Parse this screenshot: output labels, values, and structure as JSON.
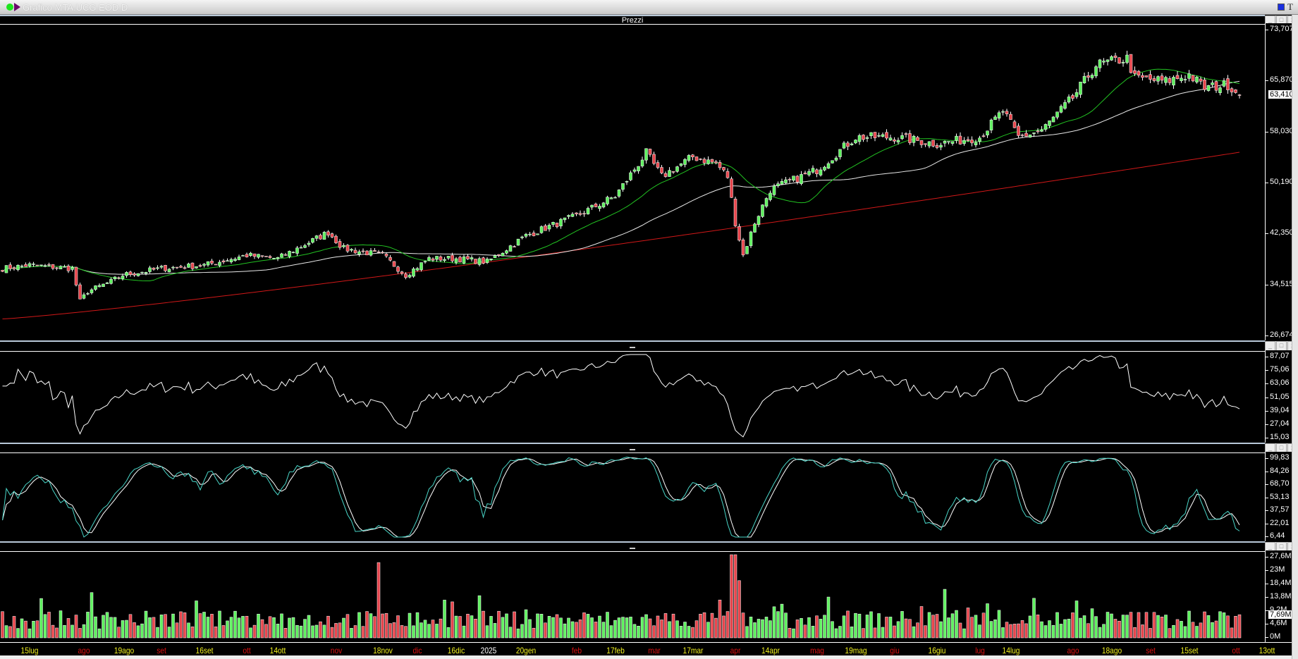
{
  "window": {
    "title": "Grafico MTA.UCG EOD D"
  },
  "panels": {
    "price": {
      "title": "Prezzi",
      "axis": [
        "73,707",
        "65,870",
        "58,030",
        "50,190",
        "42,350",
        "34,515",
        "26,674"
      ],
      "range": [
        26.674,
        73.707
      ],
      "current": "63,410"
    },
    "rsi": {
      "title": "",
      "axis": [
        "87,07",
        "75,06",
        "63,06",
        "51,05",
        "39,04",
        "27,04",
        "15,03"
      ],
      "range": [
        15.03,
        87.07
      ]
    },
    "stoch": {
      "title": "",
      "axis": [
        "99,83",
        "84,26",
        "68,70",
        "53,13",
        "37,57",
        "22,01",
        "6,44"
      ],
      "range": [
        6.44,
        99.83
      ]
    },
    "volume": {
      "title": "",
      "axis": [
        "27,6M",
        "23M",
        "18,4M",
        "13,8M",
        "9,2M",
        "4,6M",
        "0M"
      ],
      "range": [
        0,
        27.6
      ],
      "current": "7,69M"
    }
  },
  "buttons": {
    "min": "_",
    "max": "□",
    "close": "x"
  },
  "colors": {
    "up": "#5ef25e",
    "down": "#e8444b",
    "ma_short": "#22c322",
    "ma_mid": "#e8e8e8",
    "ma_long": "#d01818",
    "stoch_k": "#49d6c8",
    "stoch_d": "#ffffff",
    "day_label": "#f0f020",
    "month_label": "#dd1111",
    "year_label": "#ffffff"
  },
  "chart_data": {
    "type": "candlestick",
    "bars": 320,
    "close_anchors": [
      [
        0,
        37
      ],
      [
        7,
        37.5
      ],
      [
        18,
        37
      ],
      [
        20,
        32
      ],
      [
        22,
        33.5
      ],
      [
        28,
        35
      ],
      [
        31,
        36
      ],
      [
        41,
        37
      ],
      [
        52,
        37.5
      ],
      [
        63,
        39
      ],
      [
        71,
        38.5
      ],
      [
        84,
        42.5
      ],
      [
        88,
        40
      ],
      [
        98,
        39
      ],
      [
        104,
        36
      ],
      [
        110,
        38.5
      ],
      [
        117,
        38.5
      ],
      [
        125,
        38
      ],
      [
        135,
        42
      ],
      [
        148,
        45
      ],
      [
        158,
        48
      ],
      [
        166,
        54.6
      ],
      [
        170,
        51
      ],
      [
        178,
        54
      ],
      [
        184,
        53
      ],
      [
        187,
        51
      ],
      [
        189,
        44
      ],
      [
        191,
        39
      ],
      [
        194,
        44
      ],
      [
        198,
        49
      ],
      [
        210,
        52
      ],
      [
        220,
        57
      ],
      [
        230,
        57
      ],
      [
        241,
        56
      ],
      [
        252,
        57
      ],
      [
        258,
        61
      ],
      [
        262,
        57
      ],
      [
        268,
        58
      ],
      [
        276,
        63
      ],
      [
        282,
        68
      ],
      [
        290,
        69
      ],
      [
        292,
        66
      ],
      [
        300,
        65.5
      ],
      [
        306,
        66.5
      ],
      [
        310,
        64.5
      ],
      [
        316,
        65
      ],
      [
        319,
        63.41
      ]
    ],
    "ma_long_range": [
      29.3,
      54.7
    ],
    "volume_spikes": [
      [
        97,
        25
      ],
      [
        188,
        27.6
      ],
      [
        189,
        27.6
      ],
      [
        190,
        19
      ]
    ],
    "last_volume": 7.69,
    "date_labels": [
      {
        "i": 7,
        "t": "15lug",
        "k": "day"
      },
      {
        "i": 21,
        "t": "ago",
        "k": "month"
      },
      {
        "i": 31.4,
        "t": "19ago",
        "k": "day"
      },
      {
        "i": 41,
        "t": "set",
        "k": "month"
      },
      {
        "i": 52,
        "t": "16set",
        "k": "day"
      },
      {
        "i": 63,
        "t": "ott",
        "k": "month"
      },
      {
        "i": 71,
        "t": "14ott",
        "k": "day"
      },
      {
        "i": 86,
        "t": "nov",
        "k": "month"
      },
      {
        "i": 98,
        "t": "18nov",
        "k": "day"
      },
      {
        "i": 107,
        "t": "dic",
        "k": "month"
      },
      {
        "i": 117,
        "t": "16dic",
        "k": "day"
      },
      {
        "i": 125.4,
        "t": "2025",
        "k": "year"
      },
      {
        "i": 135,
        "t": "20gen",
        "k": "day"
      },
      {
        "i": 148,
        "t": "feb",
        "k": "month"
      },
      {
        "i": 158,
        "t": "17feb",
        "k": "day"
      },
      {
        "i": 168,
        "t": "mar",
        "k": "month"
      },
      {
        "i": 178,
        "t": "17mar",
        "k": "day"
      },
      {
        "i": 189,
        "t": "apr",
        "k": "month"
      },
      {
        "i": 198,
        "t": "14apr",
        "k": "day"
      },
      {
        "i": 210,
        "t": "mag",
        "k": "month"
      },
      {
        "i": 220,
        "t": "19mag",
        "k": "day"
      },
      {
        "i": 230,
        "t": "giu",
        "k": "month"
      },
      {
        "i": 241,
        "t": "16giu",
        "k": "day"
      },
      {
        "i": 252,
        "t": "lug",
        "k": "month"
      },
      {
        "i": 260,
        "t": "14lug",
        "k": "day"
      },
      {
        "i": 276,
        "t": "ago",
        "k": "month"
      },
      {
        "i": 286,
        "t": "18ago",
        "k": "day"
      },
      {
        "i": 296,
        "t": "set",
        "k": "month"
      },
      {
        "i": 306,
        "t": "15set",
        "k": "day"
      },
      {
        "i": 318,
        "t": "ott",
        "k": "month"
      },
      {
        "i": 326,
        "t": "13ott",
        "k": "day"
      }
    ]
  }
}
